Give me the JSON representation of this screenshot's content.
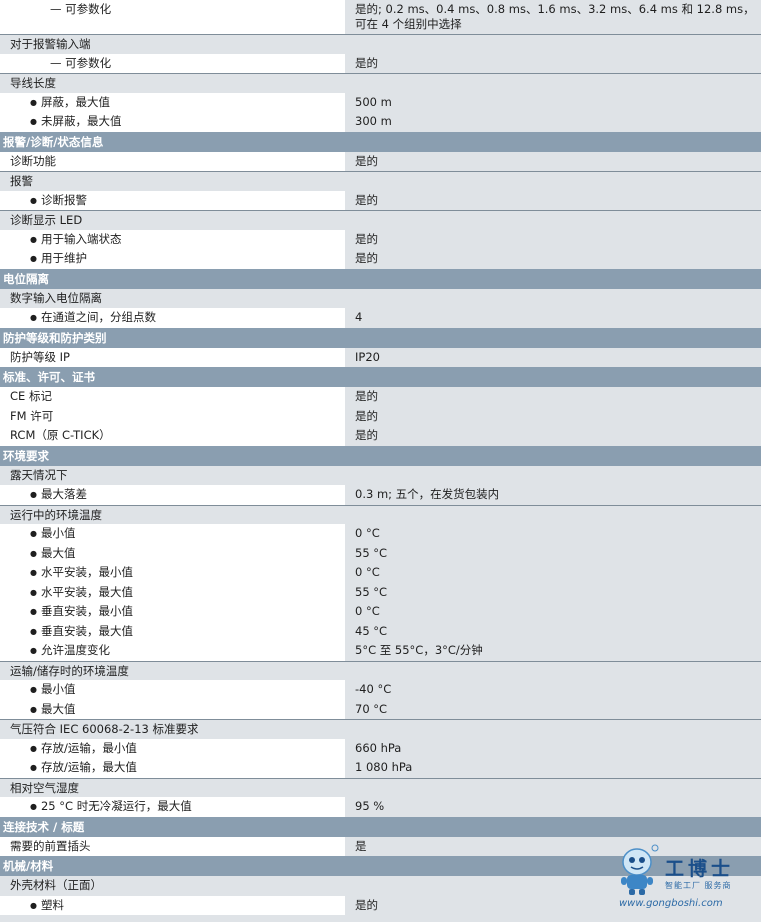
{
  "rows": [
    {
      "k": "item",
      "cls": "l3 tall",
      "label": "— 可参数化",
      "value": "是的; 0.2 ms、0.4 ms、0.8 ms、1.6 ms、3.2 ms、6.4 ms 和 12.8 ms，可在 4 个组别中选择"
    },
    {
      "k": "item",
      "cls": "grp single hl",
      "label": "对于报警输入端",
      "value": ""
    },
    {
      "k": "item",
      "cls": "l3 single",
      "label": "— 可参数化",
      "value": "是的"
    },
    {
      "k": "item",
      "cls": "grp single hl",
      "label": "导线长度",
      "value": ""
    },
    {
      "k": "item",
      "cls": "l2 single bulrow",
      "label": "屏蔽，最大值",
      "value": "500 m"
    },
    {
      "k": "item",
      "cls": "l2 single bulrow",
      "label": "未屏蔽，最大值",
      "value": "300 m"
    },
    {
      "k": "sec",
      "label": "报警/诊断/状态信息"
    },
    {
      "k": "item",
      "cls": "l1 single",
      "label": "诊断功能",
      "value": "是的"
    },
    {
      "k": "item",
      "cls": "grp single hl",
      "label": "报警",
      "value": ""
    },
    {
      "k": "item",
      "cls": "l2 single bulrow",
      "label": "诊断报警",
      "value": "是的"
    },
    {
      "k": "item",
      "cls": "grp single hl",
      "label": "诊断显示 LED",
      "value": ""
    },
    {
      "k": "item",
      "cls": "l2 single bulrow",
      "label": "用于输入端状态",
      "value": "是的"
    },
    {
      "k": "item",
      "cls": "l2 single bulrow",
      "label": "用于维护",
      "value": "是的"
    },
    {
      "k": "sec",
      "label": "电位隔离"
    },
    {
      "k": "item",
      "cls": "grp single",
      "label": "数字输入电位隔离",
      "value": ""
    },
    {
      "k": "item",
      "cls": "l2 single bulrow",
      "label": "在通道之间，分组点数",
      "value": "4"
    },
    {
      "k": "sec",
      "label": "防护等级和防护类别"
    },
    {
      "k": "item",
      "cls": "l1 single",
      "label": "防护等级 IP",
      "value": "IP20"
    },
    {
      "k": "sec",
      "label": "标准、许可、证书"
    },
    {
      "k": "item",
      "cls": "l1 single",
      "label": "CE 标记",
      "value": "是的"
    },
    {
      "k": "item",
      "cls": "l1 single",
      "label": "FM 许可",
      "value": "是的"
    },
    {
      "k": "item",
      "cls": "l1 single",
      "label": "RCM（原 C-TICK）",
      "value": "是的"
    },
    {
      "k": "sec",
      "label": "环境要求"
    },
    {
      "k": "item",
      "cls": "grp single",
      "label": "露天情况下",
      "value": ""
    },
    {
      "k": "item",
      "cls": "l2 single bulrow",
      "label": "最大落差",
      "value": "0.3 m; 五个，在发货包装内"
    },
    {
      "k": "item",
      "cls": "grp single hl",
      "label": "运行中的环境温度",
      "value": ""
    },
    {
      "k": "item",
      "cls": "l2 single bulrow",
      "label": "最小值",
      "value": "0 °C"
    },
    {
      "k": "item",
      "cls": "l2 single bulrow",
      "label": "最大值",
      "value": "55 °C"
    },
    {
      "k": "item",
      "cls": "l2 single bulrow",
      "label": "水平安装，最小值",
      "value": "0 °C"
    },
    {
      "k": "item",
      "cls": "l2 single bulrow",
      "label": "水平安装，最大值",
      "value": "55 °C"
    },
    {
      "k": "item",
      "cls": "l2 single bulrow",
      "label": "垂直安装，最小值",
      "value": "0 °C"
    },
    {
      "k": "item",
      "cls": "l2 single bulrow",
      "label": "垂直安装，最大值",
      "value": "45 °C"
    },
    {
      "k": "item",
      "cls": "l2 single bulrow",
      "label": "允许温度变化",
      "value": "5°C 至 55°C，3°C/分钟"
    },
    {
      "k": "item",
      "cls": "grp single hl",
      "label": "运输/储存时的环境温度",
      "value": ""
    },
    {
      "k": "item",
      "cls": "l2 single bulrow",
      "label": "最小值",
      "value": "-40 °C"
    },
    {
      "k": "item",
      "cls": "l2 single bulrow",
      "label": "最大值",
      "value": "70 °C"
    },
    {
      "k": "item",
      "cls": "grp single hl",
      "label": "气压符合 IEC 60068-2-13 标准要求",
      "value": ""
    },
    {
      "k": "item",
      "cls": "l2 single bulrow",
      "label": "存放/运输，最小值",
      "value": "660 hPa"
    },
    {
      "k": "item",
      "cls": "l2 single bulrow",
      "label": "存放/运输，最大值",
      "value": "1 080 hPa"
    },
    {
      "k": "item",
      "cls": "grp single hl",
      "label": "相对空气湿度",
      "value": ""
    },
    {
      "k": "item",
      "cls": "l2 single bulrow",
      "label": "25 °C 时无冷凝运行，最大值",
      "value": "95 %"
    },
    {
      "k": "sec",
      "label": "连接技术 / 标题"
    },
    {
      "k": "item",
      "cls": "l1 single",
      "label": "需要的前置插头",
      "value": "是"
    },
    {
      "k": "sec",
      "label": "机械/材料"
    },
    {
      "k": "item",
      "cls": "grp single",
      "label": "外壳材料（正面）",
      "value": ""
    },
    {
      "k": "item",
      "cls": "l2 single bulrow",
      "label": "塑料",
      "value": "是的"
    }
  ],
  "watermark": {
    "brand": "工博士",
    "tagline": "智能工厂 服务商",
    "url": "www.gongboshi.com",
    "registered": "®",
    "color": "#1b4f8a"
  }
}
